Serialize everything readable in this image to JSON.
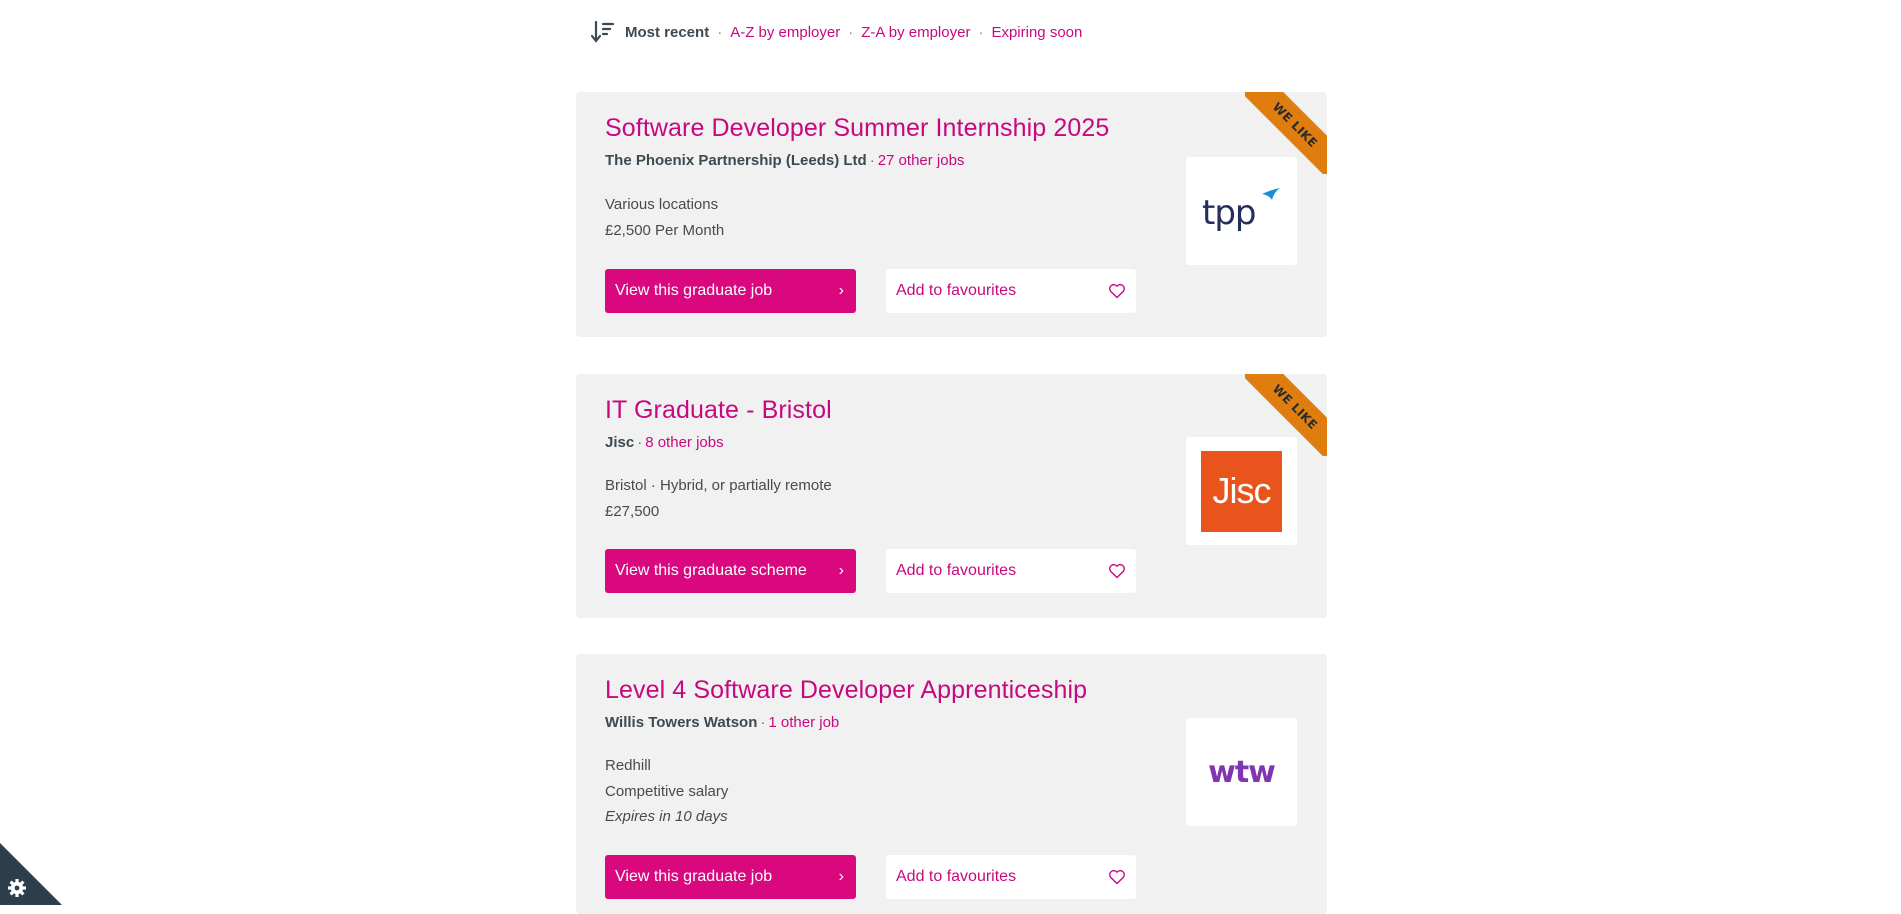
{
  "sort": {
    "current": "Most recent",
    "options": [
      "A-Z by employer",
      "Z-A by employer",
      "Expiring soon"
    ],
    "separator": "·"
  },
  "jobs": [
    {
      "title": "Software Developer Summer Internship 2025",
      "employer": "The Phoenix Partnership (Leeds) Ltd",
      "other_jobs": "27 other jobs",
      "location": "Various locations",
      "salary": "£2,500 Per Month",
      "view_label": "View this graduate job",
      "fav_label": "Add to favourites",
      "badge": "WE LIKE",
      "logo_text": "tpp",
      "logo_color": "#25305a",
      "logo_accent": "#1d8fd1"
    },
    {
      "title": "IT Graduate - Bristol",
      "employer": "Jisc",
      "other_jobs": "8 other jobs",
      "location": "Bristol · Hybrid, or partially remote",
      "salary": "£27,500",
      "view_label": "View this graduate scheme",
      "fav_label": "Add to favourites",
      "badge": "WE LIKE",
      "logo_text": "Jisc",
      "logo_color": "#e8541c"
    },
    {
      "title": "Level 4 Software Developer Apprenticeship",
      "employer": "Willis Towers Watson",
      "other_jobs": "1 other job",
      "location": "Redhill",
      "salary": "Competitive salary",
      "expires": "Expires in 10 days",
      "view_label": "View this graduate job",
      "fav_label": "Add to favourites",
      "logo_text": "wtw",
      "logo_color": "#7f35b2"
    }
  ],
  "colors": {
    "accent": "#c7097f",
    "button": "#d9087f",
    "ribbon": "#df7d0e",
    "card_bg": "#f1f1f1",
    "cookie_bg": "#2c3e4b"
  },
  "icons": {
    "sort": "sort-descending-icon",
    "chevron": "chevron-right-icon",
    "heart": "heart-outline-icon",
    "cookie": "gear-icon"
  }
}
